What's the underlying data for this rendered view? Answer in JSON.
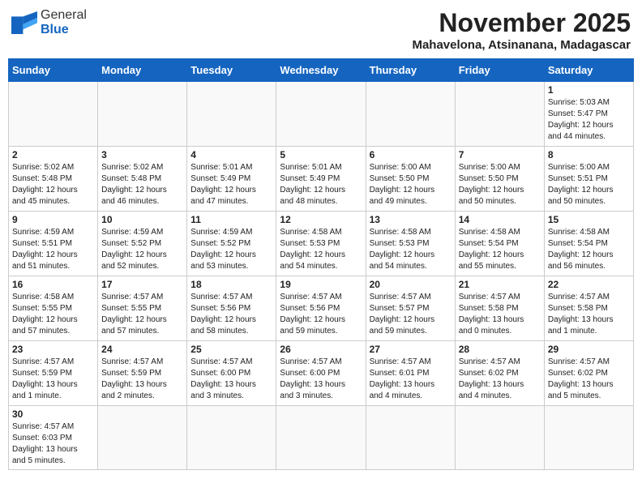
{
  "header": {
    "logo": {
      "general": "General",
      "blue": "Blue"
    },
    "month_title": "November 2025",
    "location": "Mahavelona, Atsinanana, Madagascar"
  },
  "weekdays": [
    "Sunday",
    "Monday",
    "Tuesday",
    "Wednesday",
    "Thursday",
    "Friday",
    "Saturday"
  ],
  "weeks": [
    [
      {
        "day": "",
        "info": ""
      },
      {
        "day": "",
        "info": ""
      },
      {
        "day": "",
        "info": ""
      },
      {
        "day": "",
        "info": ""
      },
      {
        "day": "",
        "info": ""
      },
      {
        "day": "",
        "info": ""
      },
      {
        "day": "1",
        "info": "Sunrise: 5:03 AM\nSunset: 5:47 PM\nDaylight: 12 hours\nand 44 minutes."
      }
    ],
    [
      {
        "day": "2",
        "info": "Sunrise: 5:02 AM\nSunset: 5:48 PM\nDaylight: 12 hours\nand 45 minutes."
      },
      {
        "day": "3",
        "info": "Sunrise: 5:02 AM\nSunset: 5:48 PM\nDaylight: 12 hours\nand 46 minutes."
      },
      {
        "day": "4",
        "info": "Sunrise: 5:01 AM\nSunset: 5:49 PM\nDaylight: 12 hours\nand 47 minutes."
      },
      {
        "day": "5",
        "info": "Sunrise: 5:01 AM\nSunset: 5:49 PM\nDaylight: 12 hours\nand 48 minutes."
      },
      {
        "day": "6",
        "info": "Sunrise: 5:00 AM\nSunset: 5:50 PM\nDaylight: 12 hours\nand 49 minutes."
      },
      {
        "day": "7",
        "info": "Sunrise: 5:00 AM\nSunset: 5:50 PM\nDaylight: 12 hours\nand 50 minutes."
      },
      {
        "day": "8",
        "info": "Sunrise: 5:00 AM\nSunset: 5:51 PM\nDaylight: 12 hours\nand 50 minutes."
      }
    ],
    [
      {
        "day": "9",
        "info": "Sunrise: 4:59 AM\nSunset: 5:51 PM\nDaylight: 12 hours\nand 51 minutes."
      },
      {
        "day": "10",
        "info": "Sunrise: 4:59 AM\nSunset: 5:52 PM\nDaylight: 12 hours\nand 52 minutes."
      },
      {
        "day": "11",
        "info": "Sunrise: 4:59 AM\nSunset: 5:52 PM\nDaylight: 12 hours\nand 53 minutes."
      },
      {
        "day": "12",
        "info": "Sunrise: 4:58 AM\nSunset: 5:53 PM\nDaylight: 12 hours\nand 54 minutes."
      },
      {
        "day": "13",
        "info": "Sunrise: 4:58 AM\nSunset: 5:53 PM\nDaylight: 12 hours\nand 54 minutes."
      },
      {
        "day": "14",
        "info": "Sunrise: 4:58 AM\nSunset: 5:54 PM\nDaylight: 12 hours\nand 55 minutes."
      },
      {
        "day": "15",
        "info": "Sunrise: 4:58 AM\nSunset: 5:54 PM\nDaylight: 12 hours\nand 56 minutes."
      }
    ],
    [
      {
        "day": "16",
        "info": "Sunrise: 4:58 AM\nSunset: 5:55 PM\nDaylight: 12 hours\nand 57 minutes."
      },
      {
        "day": "17",
        "info": "Sunrise: 4:57 AM\nSunset: 5:55 PM\nDaylight: 12 hours\nand 57 minutes."
      },
      {
        "day": "18",
        "info": "Sunrise: 4:57 AM\nSunset: 5:56 PM\nDaylight: 12 hours\nand 58 minutes."
      },
      {
        "day": "19",
        "info": "Sunrise: 4:57 AM\nSunset: 5:56 PM\nDaylight: 12 hours\nand 59 minutes."
      },
      {
        "day": "20",
        "info": "Sunrise: 4:57 AM\nSunset: 5:57 PM\nDaylight: 12 hours\nand 59 minutes."
      },
      {
        "day": "21",
        "info": "Sunrise: 4:57 AM\nSunset: 5:58 PM\nDaylight: 13 hours\nand 0 minutes."
      },
      {
        "day": "22",
        "info": "Sunrise: 4:57 AM\nSunset: 5:58 PM\nDaylight: 13 hours\nand 1 minute."
      }
    ],
    [
      {
        "day": "23",
        "info": "Sunrise: 4:57 AM\nSunset: 5:59 PM\nDaylight: 13 hours\nand 1 minute."
      },
      {
        "day": "24",
        "info": "Sunrise: 4:57 AM\nSunset: 5:59 PM\nDaylight: 13 hours\nand 2 minutes."
      },
      {
        "day": "25",
        "info": "Sunrise: 4:57 AM\nSunset: 6:00 PM\nDaylight: 13 hours\nand 3 minutes."
      },
      {
        "day": "26",
        "info": "Sunrise: 4:57 AM\nSunset: 6:00 PM\nDaylight: 13 hours\nand 3 minutes."
      },
      {
        "day": "27",
        "info": "Sunrise: 4:57 AM\nSunset: 6:01 PM\nDaylight: 13 hours\nand 4 minutes."
      },
      {
        "day": "28",
        "info": "Sunrise: 4:57 AM\nSunset: 6:02 PM\nDaylight: 13 hours\nand 4 minutes."
      },
      {
        "day": "29",
        "info": "Sunrise: 4:57 AM\nSunset: 6:02 PM\nDaylight: 13 hours\nand 5 minutes."
      }
    ],
    [
      {
        "day": "30",
        "info": "Sunrise: 4:57 AM\nSunset: 6:03 PM\nDaylight: 13 hours\nand 5 minutes."
      },
      {
        "day": "",
        "info": ""
      },
      {
        "day": "",
        "info": ""
      },
      {
        "day": "",
        "info": ""
      },
      {
        "day": "",
        "info": ""
      },
      {
        "day": "",
        "info": ""
      },
      {
        "day": "",
        "info": ""
      }
    ]
  ]
}
